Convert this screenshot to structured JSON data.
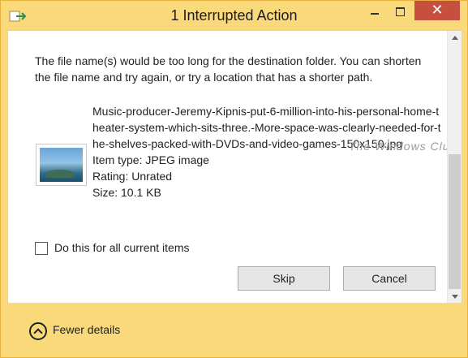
{
  "window": {
    "title": "1 Interrupted Action",
    "close_glyph": "✕"
  },
  "message": "The file name(s) would be too long for the destination folder. You can shorten the file name and try again, or try a location that has a shorter path.",
  "file": {
    "name": "Music-producer-Jeremy-Kipnis-put-6-million-into-his-personal-home-theater-system-which-sits-three.-More-space-was-clearly-needed-for-the-shelves-packed-with-DVDs-and-video-games-150x150.jpg",
    "item_type": "Item type: JPEG image",
    "rating": "Rating: Unrated",
    "size": "Size: 10.1 KB",
    "thumbnail_icon": "landscape-image-icon"
  },
  "watermark": "The Windows Club",
  "checkbox": {
    "label": "Do this for all current items",
    "checked": false
  },
  "buttons": {
    "skip": "Skip",
    "cancel": "Cancel"
  },
  "footer": {
    "fewer_details": "Fewer details",
    "icon": "chevron-up-circle-icon"
  },
  "colors": {
    "frame": "#f9d97a",
    "close_button": "#c74f3f"
  }
}
